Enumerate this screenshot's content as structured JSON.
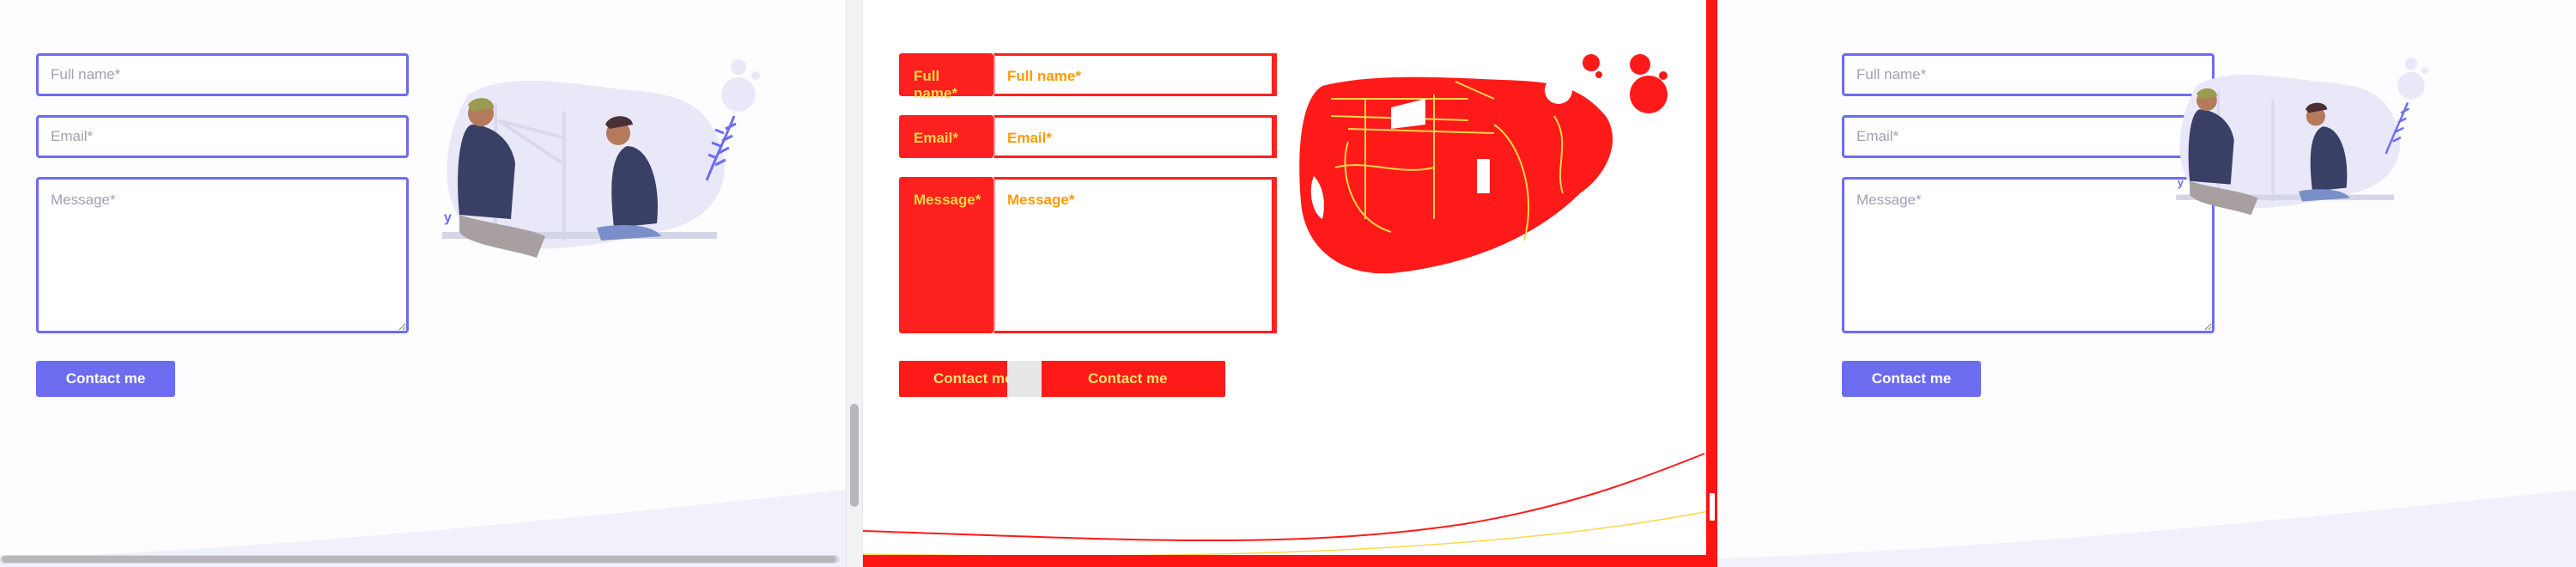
{
  "form": {
    "full_name_placeholder": "Full name*",
    "email_placeholder": "Email*",
    "message_placeholder": "Message*",
    "submit_label": "Contact me"
  },
  "diff": {
    "full_name_label": "Full name*",
    "email_label": "Email*",
    "message_label": "Message*",
    "button_label": "Contact me"
  },
  "colors": {
    "accent": "#6c6cf0",
    "diff_red": "#ff1a1a",
    "diff_text": "#ffd64a"
  },
  "icons": {
    "illustration": "people-meeting-illustration"
  }
}
